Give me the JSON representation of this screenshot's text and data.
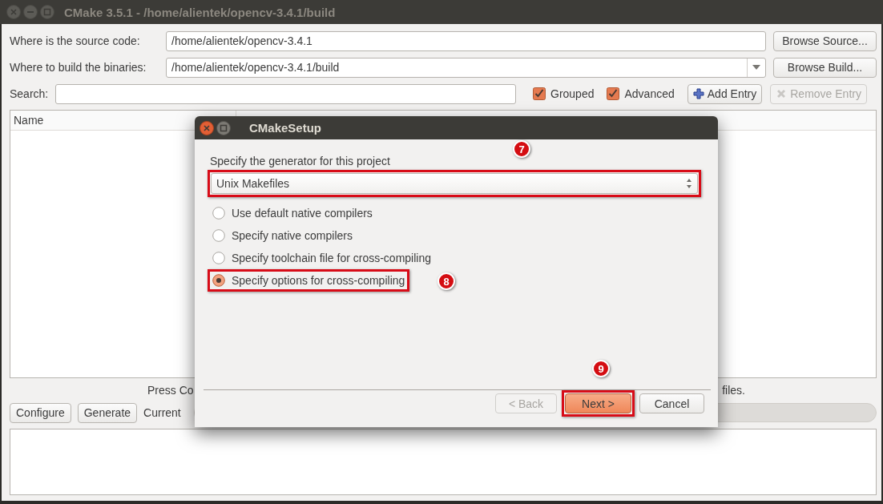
{
  "window": {
    "title": "CMake 3.5.1 - /home/alientek/opencv-3.4.1/build"
  },
  "paths": [
    {
      "label": "Where is the source code:",
      "value": "/home/alientek/opencv-3.4.1",
      "kind": "text",
      "button": "Browse Source..."
    },
    {
      "label": "Where to build the binaries:",
      "value": "/home/alientek/opencv-3.4.1/build",
      "kind": "combo",
      "button": "Browse Build..."
    }
  ],
  "search": {
    "label": "Search:"
  },
  "options": [
    {
      "label": "Grouped",
      "checked": true
    },
    {
      "label": "Advanced",
      "checked": true
    }
  ],
  "entry_buttons": [
    {
      "label": "Add Entry",
      "kind": "add",
      "disabled": false
    },
    {
      "label": "Remove Entry",
      "kind": "remove",
      "disabled": true
    }
  ],
  "table": {
    "columns": [
      "Name"
    ]
  },
  "status": [
    "Press Co",
    "files."
  ],
  "actions": [
    {
      "label": "Configure"
    },
    {
      "label": "Generate"
    }
  ],
  "generator_label": "Current",
  "progress": {
    "level": 0
  },
  "dialog": {
    "title": "CMakeSetup",
    "prompt": "Specify the generator for this project",
    "generator": {
      "value": "Unix Makefiles",
      "highlighted": true
    },
    "compilers": [
      {
        "label": "Use default native compilers",
        "selected": false,
        "highlighted": false
      },
      {
        "label": "Specify native compilers",
        "selected": false,
        "highlighted": false
      },
      {
        "label": "Specify toolchain file for cross-compiling",
        "selected": false,
        "highlighted": false
      },
      {
        "label": "Specify options for cross-compiling",
        "selected": true,
        "highlighted": true
      }
    ],
    "buttons": [
      {
        "label": "< Back",
        "disabled": true,
        "default": false,
        "highlighted": false
      },
      {
        "label": "Next >",
        "disabled": false,
        "default": true,
        "highlighted": true
      },
      {
        "label": "Cancel",
        "disabled": false,
        "default": false,
        "highlighted": false
      }
    ]
  },
  "annotations": [
    {
      "label": "7"
    },
    {
      "label": "8"
    },
    {
      "label": "9"
    }
  ]
}
